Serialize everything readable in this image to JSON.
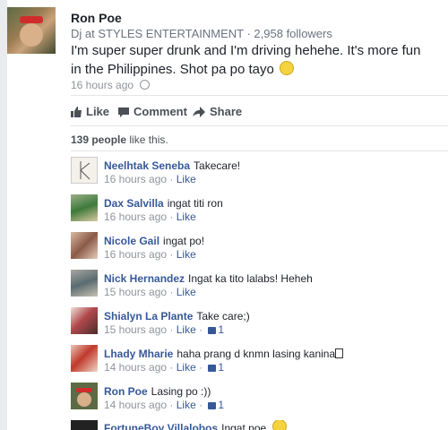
{
  "post": {
    "author": "Ron Poe",
    "meta": "Dj at STYLES ENTERTAINMENT · 2,958 followers",
    "text": "I'm super super drunk and I'm driving hehehe. It's more fun in the Philippines. Shot pa po tayo",
    "time": "16 hours ago"
  },
  "actions": {
    "like": "Like",
    "comment": "Comment",
    "share": "Share"
  },
  "likes": {
    "count": "139 people",
    "suffix": "like this."
  },
  "comments": [
    {
      "name": "Neelhtak Seneba",
      "text": "Takecare!",
      "time": "16 hours ago",
      "like": "Like",
      "likes": ""
    },
    {
      "name": "Dax Salvilla",
      "text": "ingat titi ron",
      "time": "16 hours ago",
      "like": "Like",
      "likes": ""
    },
    {
      "name": "Nicole Gail",
      "text": "ingat po!",
      "time": "16 hours ago",
      "like": "Like",
      "likes": ""
    },
    {
      "name": "Nick Hernandez",
      "text": "Ingat ka tito lalabs! Heheh",
      "time": "15 hours ago",
      "like": "Like",
      "likes": ""
    },
    {
      "name": "Shialyn La Plante",
      "text": "Take care;)",
      "time": "15 hours ago",
      "like": "Like",
      "likes": "1"
    },
    {
      "name": "Lhady Mharie",
      "text": "haha prang d knmn lasing kanina",
      "time": "14 hours ago",
      "like": "Like",
      "likes": "1"
    },
    {
      "name": "Ron Poe",
      "text": "Lasing po :))",
      "time": "14 hours ago",
      "like": "Like",
      "likes": "1"
    },
    {
      "name": "FortuneBoy Villalobos",
      "text": "Ingat poe",
      "time": "",
      "like": "",
      "likes": ""
    }
  ],
  "colors": {
    "link": "#365899",
    "muted": "#90949c",
    "background": "#e9ebee"
  },
  "icons": [
    "globe-icon",
    "thumbs-up-icon",
    "comment-icon",
    "share-arrow-icon",
    "smiley-icon",
    "like-count-thumb-icon"
  ]
}
